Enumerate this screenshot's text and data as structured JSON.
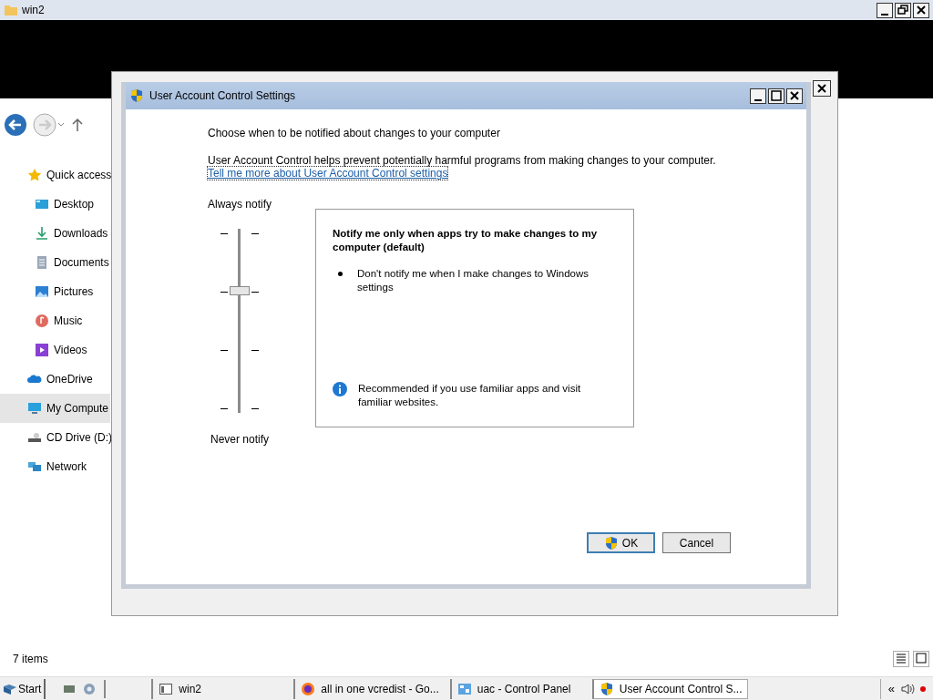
{
  "explorer": {
    "title": "win2",
    "nav_items": [
      {
        "label": "Quick access",
        "kind": "star",
        "selected": false,
        "children": [
          {
            "label": "Desktop",
            "kind": "desktop",
            "selected": false
          },
          {
            "label": "Downloads",
            "kind": "download",
            "selected": false
          },
          {
            "label": "Documents",
            "kind": "document",
            "selected": false
          },
          {
            "label": "Pictures",
            "kind": "picture",
            "selected": false
          },
          {
            "label": "Music",
            "kind": "music",
            "selected": false
          },
          {
            "label": "Videos",
            "kind": "video",
            "selected": false
          }
        ]
      },
      {
        "label": "OneDrive",
        "kind": "cloud",
        "selected": false
      },
      {
        "label": "My Compute",
        "kind": "computer",
        "selected": true
      },
      {
        "label": "CD Drive (D:)",
        "kind": "drive",
        "selected": false
      },
      {
        "label": "Network",
        "kind": "network",
        "selected": false
      }
    ],
    "status_text": "7 items"
  },
  "dialog": {
    "title": "User Account Control Settings",
    "heading": "Choose when to be notified about changes to your computer",
    "description": "User Account Control helps prevent potentially harmful programs from making changes to your computer.",
    "link": "Tell me more about User Account Control settings",
    "slider": {
      "top_label": "Always notify",
      "bottom_label": "Never notify",
      "level": 0.67
    },
    "info": {
      "title": "Notify me only when apps try to make changes to my computer (default)",
      "bullet": "Don't notify me when I make changes to Windows settings",
      "note": "Recommended if you use familiar apps and visit familiar websites."
    },
    "buttons": [
      {
        "label": "OK",
        "kind": "shield"
      },
      {
        "label": "Cancel",
        "kind": "plain"
      }
    ]
  },
  "taskbar": {
    "start": "Start",
    "tasks": [
      {
        "label": "win2",
        "kind": "window",
        "selected": false
      },
      {
        "label": "all in one vcredist - Go...",
        "kind": "firefox",
        "selected": false
      },
      {
        "label": "uac - Control Panel",
        "kind": "panel",
        "selected": false
      },
      {
        "label": "User Account Control S...",
        "kind": "shield",
        "selected": true
      }
    ],
    "tray_chevron": "«"
  }
}
